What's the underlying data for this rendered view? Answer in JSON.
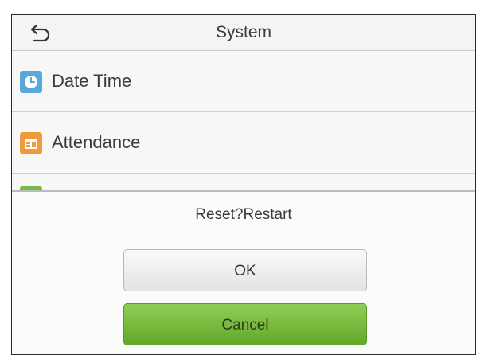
{
  "header": {
    "title": "System",
    "back_icon": "back-arrow-icon"
  },
  "menu": {
    "items": [
      {
        "label": "Date Time",
        "icon": "clock-icon",
        "color": "#5aa7dc"
      },
      {
        "label": "Attendance",
        "icon": "attendance-icon",
        "color": "#f09a3e"
      }
    ],
    "partial_item_icon_color": "#78b94a"
  },
  "dialog": {
    "message": "Reset?Restart",
    "ok_label": "OK",
    "cancel_label": "Cancel",
    "cancel_color": "#6fb23a"
  }
}
